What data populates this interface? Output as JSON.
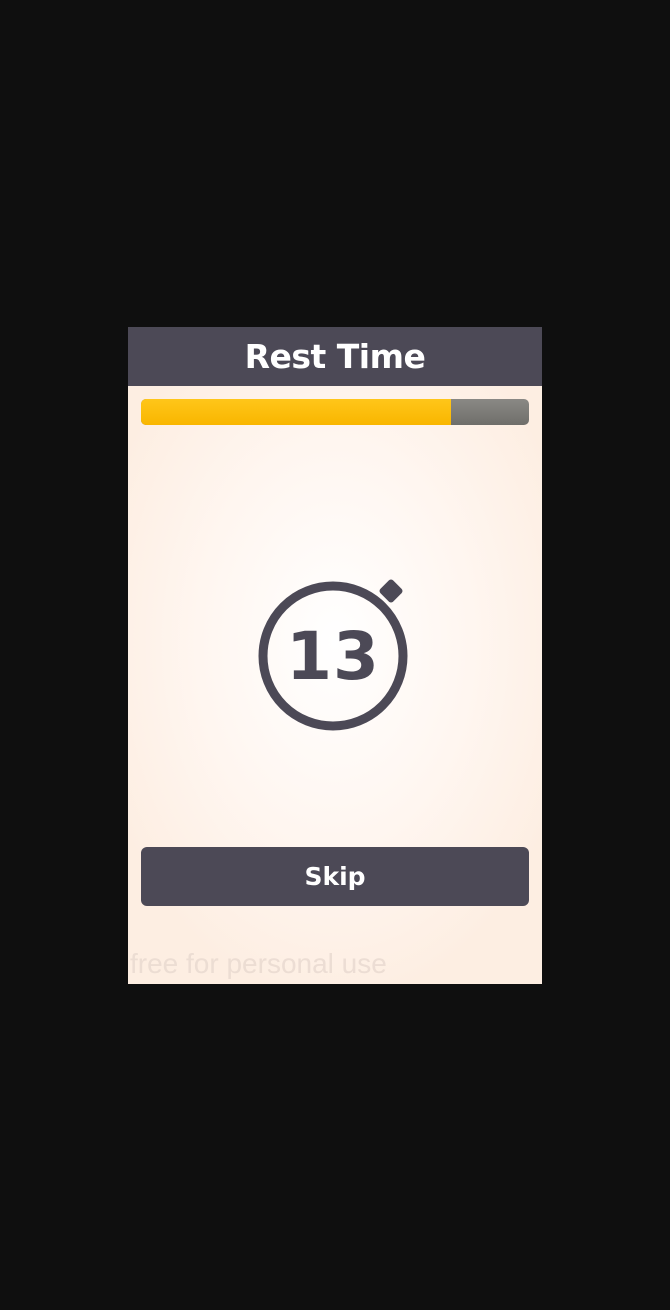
{
  "dialog": {
    "title": "Rest Time",
    "progress_fraction": 0.8,
    "progress_color": "#ffc107",
    "progress_track_color": "#7a7976",
    "timer_value": "13",
    "timer_icon": "stopwatch-icon",
    "skip_label": "Skip",
    "watermark": "free for personal use",
    "accent_color": "#4c4956"
  }
}
